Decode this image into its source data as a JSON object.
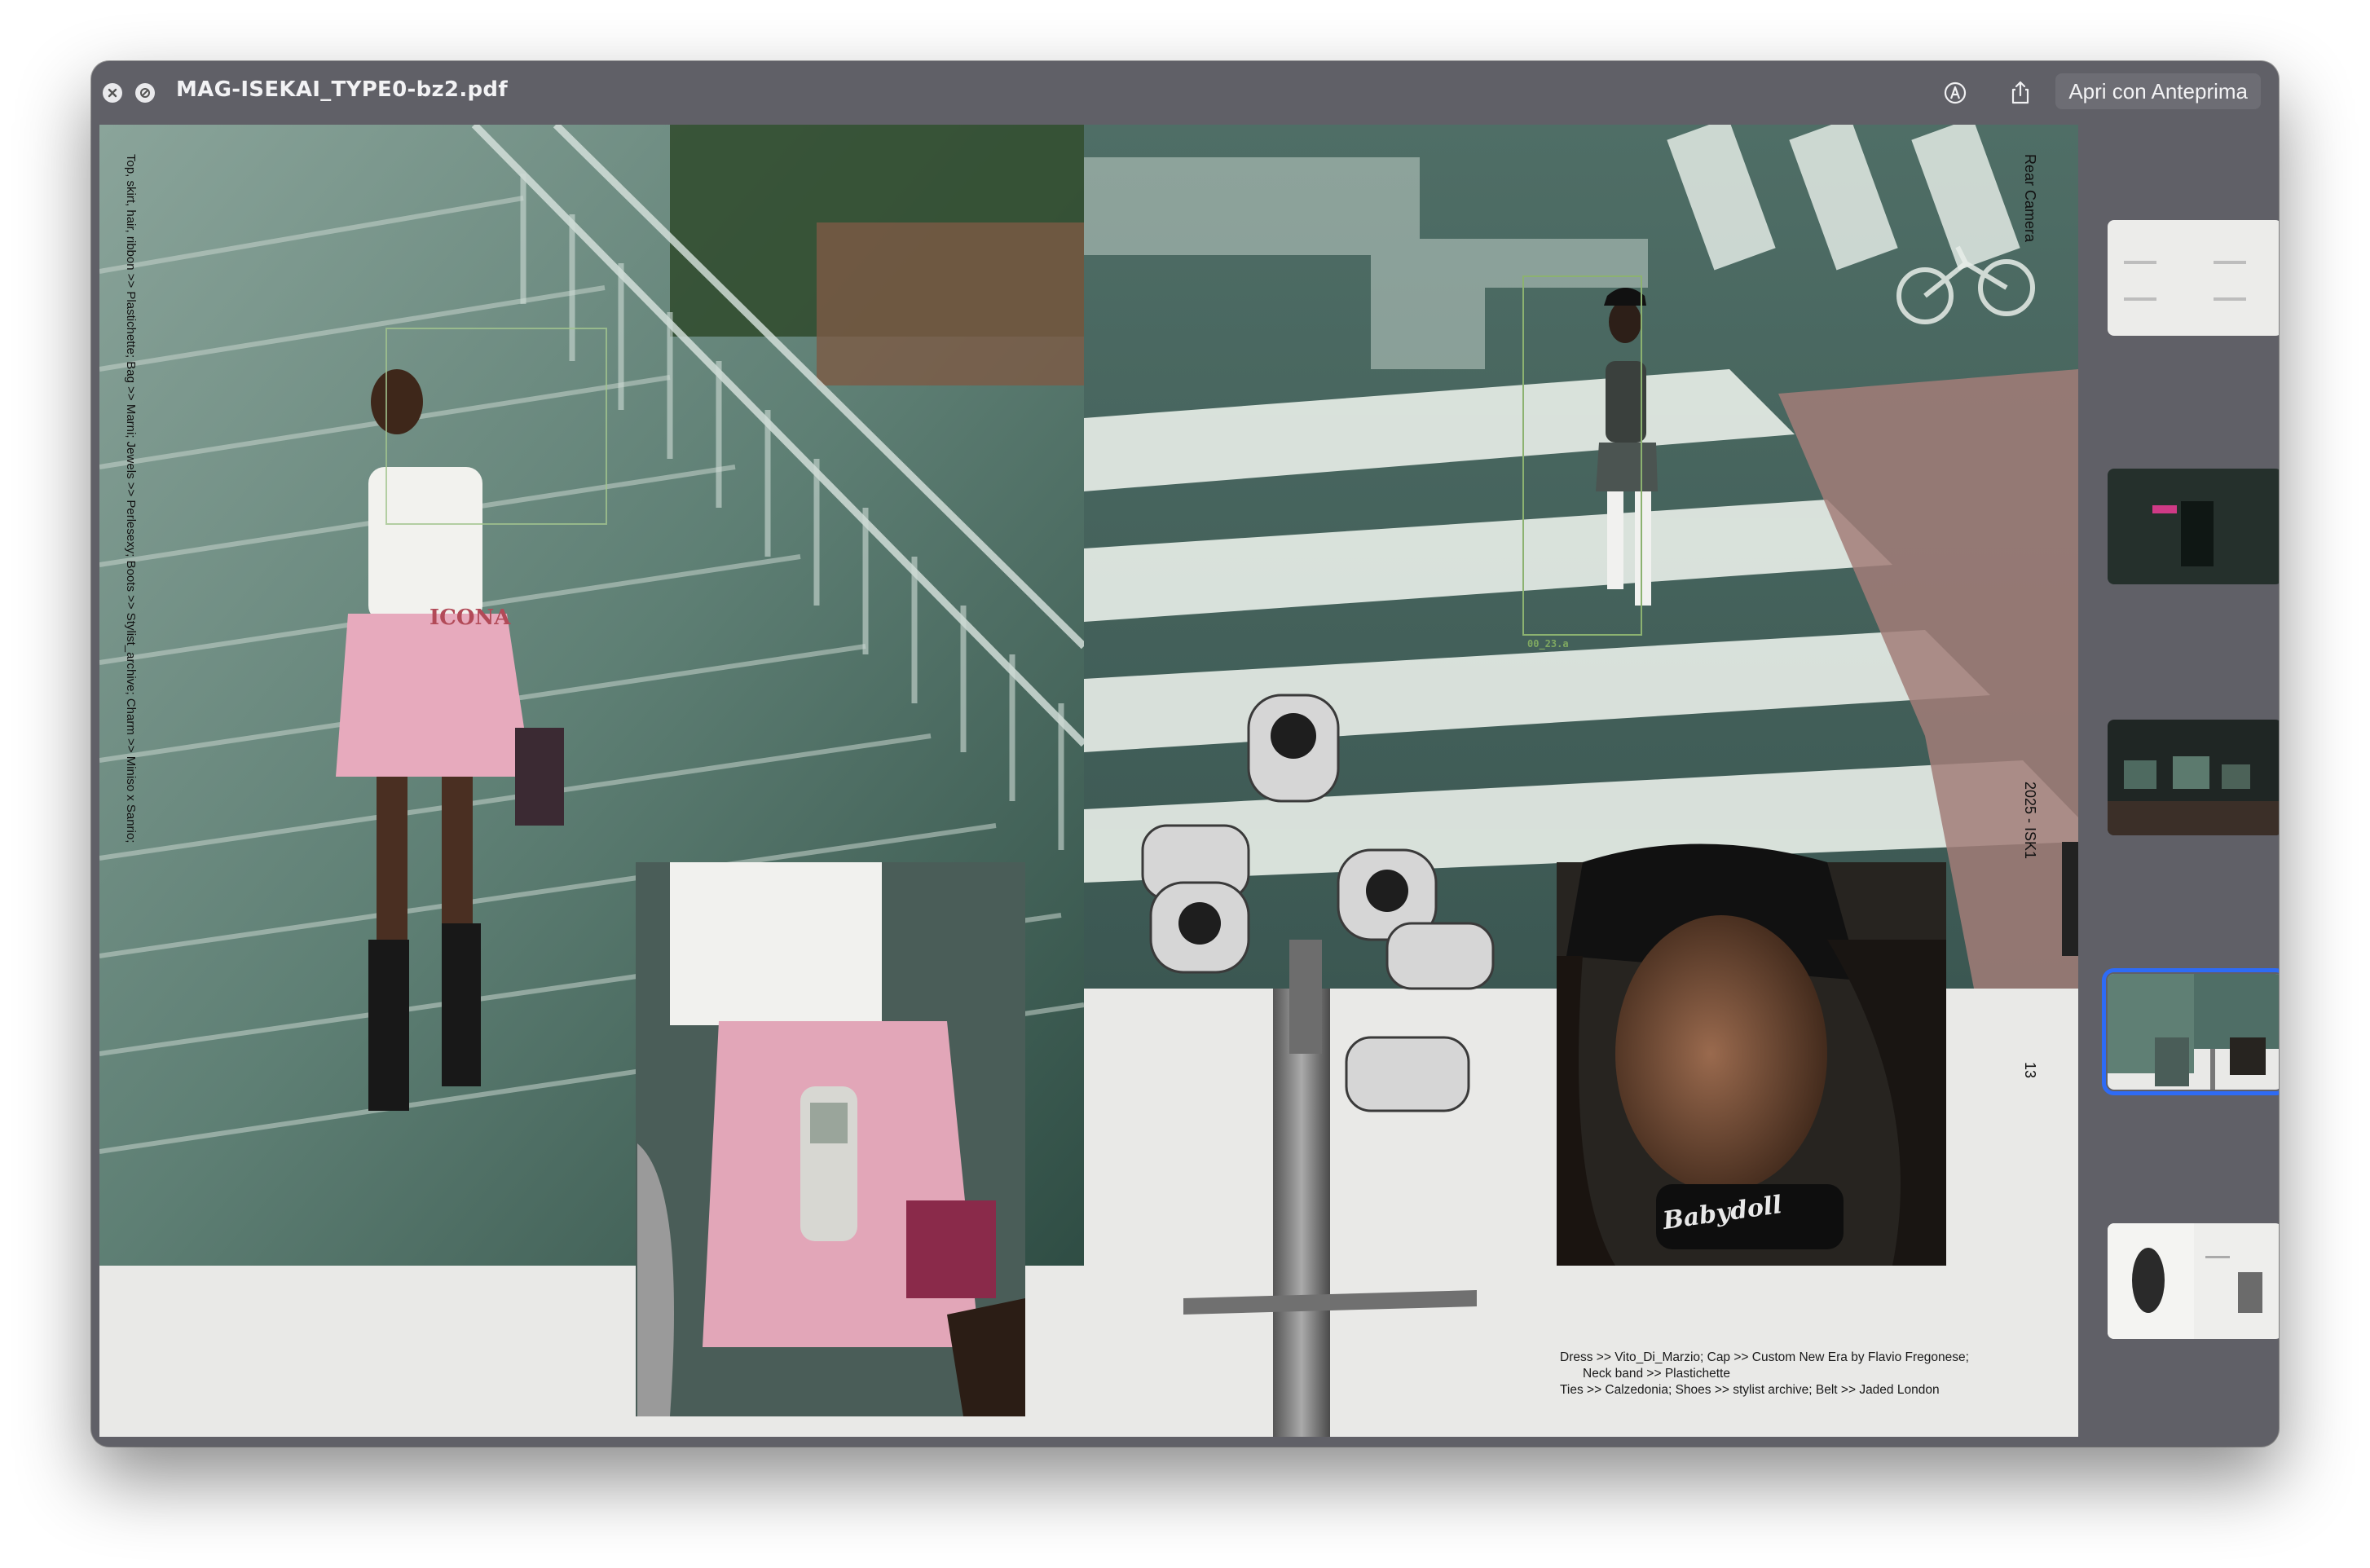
{
  "window": {
    "title": "MAG-ISEKAI_TYPE0-bz2.pdf",
    "open_with_label": "Apri con Anteprima"
  },
  "page": {
    "credits_vertical": "Top, skirt, hair, ribbon >> Plastichette; Bag >> Marni; Jewels >> Perlesexy; Boots >> Stylist_archive; Charm >> Miniso x Sanrio;",
    "shirt_text": "ICONA",
    "detection_label": "00_23.a",
    "top_right_vertical": "Rear Camera",
    "mid_right_vertical": "2025 - ISK1",
    "page_number": "13",
    "choker_text": "Babydoll",
    "caption": {
      "line1": "Dress >> Vito_Di_Marzio; Cap >> Custom New Era by Flavio Fregonese;",
      "line2": "Neck band >> Plastichette",
      "line3": "Ties >> Calzedonia; Shoes >> stylist archive; Belt >> Jaded London"
    }
  },
  "sidebar": {
    "thumbnails": [
      {
        "name": "thumbnail-page-1",
        "selected": false
      },
      {
        "name": "thumbnail-page-2",
        "selected": false
      },
      {
        "name": "thumbnail-page-3",
        "selected": false
      },
      {
        "name": "thumbnail-page-4",
        "selected": true
      },
      {
        "name": "thumbnail-page-5",
        "selected": false
      },
      {
        "name": "thumbnail-page-6",
        "selected": false
      }
    ]
  },
  "colors": {
    "window_bg": "#606067",
    "doc_bg": "#e9e9e7",
    "selection": "#2e6bf5"
  }
}
